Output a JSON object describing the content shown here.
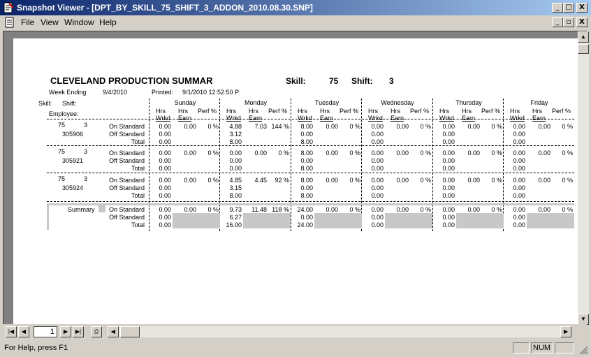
{
  "window": {
    "title": "Snapshot Viewer - [DPT_BY_SKILL_75_SHIFT_3_ADDON_2010.08.30.SNP]",
    "app_icon": "snapshot-app-icon",
    "min_label": "_",
    "max_label": "□",
    "close_label": "X"
  },
  "menu": {
    "items": [
      "File",
      "View",
      "Window",
      "Help"
    ],
    "doc_min": "_",
    "doc_restore": "▫",
    "doc_close": "X"
  },
  "report": {
    "title": "CLEVELAND PRODUCTION SUMMAR",
    "skill_label": "Skill:",
    "skill_value": "75",
    "shift_label": "Shift:",
    "shift_value": "3",
    "week_ending_label": "Week Ending",
    "week_ending_value": "9/4/2010",
    "printed_label": "Printed:",
    "printed_value": "9/1/2010  12:52:50 P",
    "col_skill": "Skill:",
    "col_shift": "Shift:",
    "col_employee": "Employee:",
    "days": [
      "Sunday",
      "Monday",
      "Tuesday",
      "Wednesday",
      "Thursday",
      "Friday"
    ],
    "sub_hrs": "Hrs",
    "sub_wrkd": "Wrkd",
    "sub_earn": "Earn",
    "sub_perf": "Perf %",
    "row_labels": [
      "On Standard",
      "Off Standard",
      "Total"
    ],
    "employees": [
      {
        "skill": "75",
        "shift": "3",
        "id": "305906",
        "days": [
          {
            "on": [
              "0.00",
              "0.00",
              "0 %"
            ],
            "off": "0.00",
            "total": "0.00"
          },
          {
            "on": [
              "4.88",
              "7.03",
              "144 %"
            ],
            "off": "3.12",
            "total": "8.00"
          },
          {
            "on": [
              "8.00",
              "0.00",
              "0 %"
            ],
            "off": "0.00",
            "total": "8.00"
          },
          {
            "on": [
              "0.00",
              "0.00",
              "0 %"
            ],
            "off": "0.00",
            "total": "0.00"
          },
          {
            "on": [
              "0.00",
              "0.00",
              "0 %"
            ],
            "off": "0.00",
            "total": "0.00"
          },
          {
            "on": [
              "0.00",
              "0.00",
              "0 %"
            ],
            "off": "0.00",
            "total": "0.00"
          }
        ]
      },
      {
        "skill": "75",
        "shift": "3",
        "id": "305921",
        "days": [
          {
            "on": [
              "0.00",
              "0.00",
              "0 %"
            ],
            "off": "0.00",
            "total": "0.00"
          },
          {
            "on": [
              "0.00",
              "0.00",
              "0 %"
            ],
            "off": "0.00",
            "total": "0.00"
          },
          {
            "on": [
              "8.00",
              "0.00",
              "0 %"
            ],
            "off": "0.00",
            "total": "8.00"
          },
          {
            "on": [
              "0.00",
              "0.00",
              "0 %"
            ],
            "off": "0.00",
            "total": "0.00"
          },
          {
            "on": [
              "0.00",
              "0.00",
              "0 %"
            ],
            "off": "0.00",
            "total": "0.00"
          },
          {
            "on": [
              "0.00",
              "0.00",
              "0 %"
            ],
            "off": "0.00",
            "total": "0.00"
          }
        ]
      },
      {
        "skill": "75",
        "shift": "3",
        "id": "305924",
        "days": [
          {
            "on": [
              "0.00",
              "0.00",
              "0 %"
            ],
            "off": "0.00",
            "total": "0.00"
          },
          {
            "on": [
              "4.85",
              "4.45",
              "92 %"
            ],
            "off": "3.15",
            "total": "8.00"
          },
          {
            "on": [
              "8.00",
              "0.00",
              "0 %"
            ],
            "off": "0.00",
            "total": "8.00"
          },
          {
            "on": [
              "0.00",
              "0.00",
              "0 %"
            ],
            "off": "0.00",
            "total": "0.00"
          },
          {
            "on": [
              "0.00",
              "0.00",
              "0 %"
            ],
            "off": "0.00",
            "total": "0.00"
          },
          {
            "on": [
              "0.00",
              "0.00",
              "0 %"
            ],
            "off": "0.00",
            "total": "0.00"
          }
        ]
      }
    ],
    "summary_label": "Summary",
    "summary": [
      {
        "on": [
          "0.00",
          "0.00",
          "0 %"
        ],
        "off": "0.00",
        "total": "0.00"
      },
      {
        "on": [
          "9.73",
          "11.48",
          "118 %"
        ],
        "off": "6.27",
        "total": "16.00"
      },
      {
        "on": [
          "24.00",
          "0.00",
          "0 %"
        ],
        "off": "0.00",
        "total": "24.00"
      },
      {
        "on": [
          "0.00",
          "0.00",
          "0 %"
        ],
        "off": "0.00",
        "total": "0.00"
      },
      {
        "on": [
          "0.00",
          "0.00",
          "0 %"
        ],
        "off": "0.00",
        "total": "0.00"
      },
      {
        "on": [
          "0.00",
          "0.00",
          "0 %"
        ],
        "off": "0.00",
        "total": "0.00"
      }
    ]
  },
  "nav": {
    "page_number": "1",
    "first_icon": "first-page-icon",
    "prev_icon": "prev-page-icon",
    "next_icon": "next-page-icon",
    "last_icon": "last-page-icon",
    "print_icon": "printer-icon"
  },
  "status": {
    "help_text": "For Help, press F1",
    "num_indicator": "NUM"
  }
}
